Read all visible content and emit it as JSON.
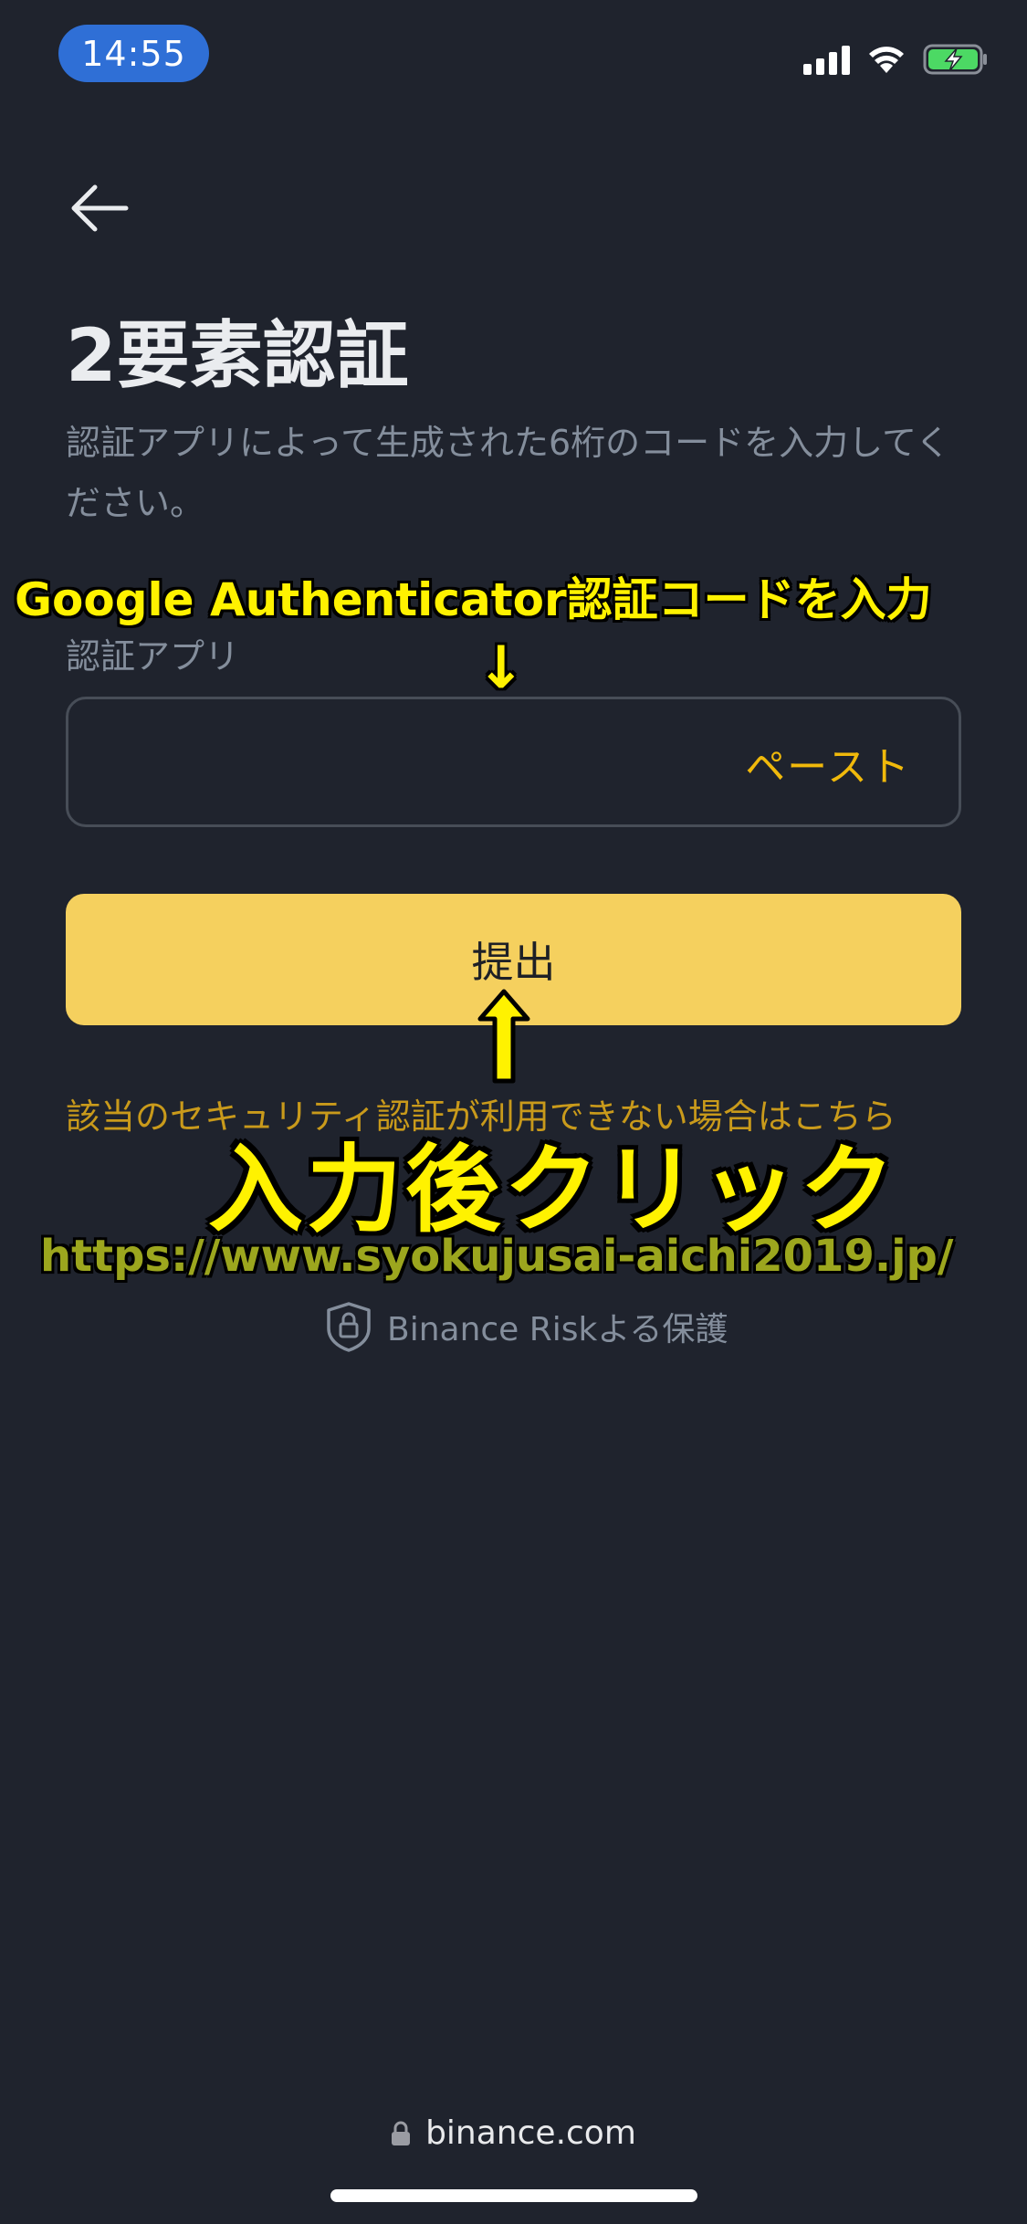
{
  "status_bar": {
    "time": "14:55"
  },
  "header": {
    "title": "2要素認証"
  },
  "description": "認証アプリによって生成された6桁のコードを入力してください。",
  "form": {
    "field_label": "認証アプリ",
    "input_value": "",
    "paste_label": "ペースト",
    "submit_label": "提出"
  },
  "security_link": "該当のセキュリティ認証が利用できない場合はこちら",
  "protection_text": "Binance Riskよる保護",
  "browser": {
    "domain": "binance.com"
  },
  "annotations": {
    "top_text": "Google Authenticator認証コードを入力",
    "down_arrow": "↓",
    "big_text": "入力後クリック",
    "watermark_url": "https://www.syokujusai-aichi2019.jp/"
  },
  "colors": {
    "background": "#1f232d",
    "accent": "#f0b90b",
    "button": "#f5d05e",
    "annotation": "#fff200"
  }
}
